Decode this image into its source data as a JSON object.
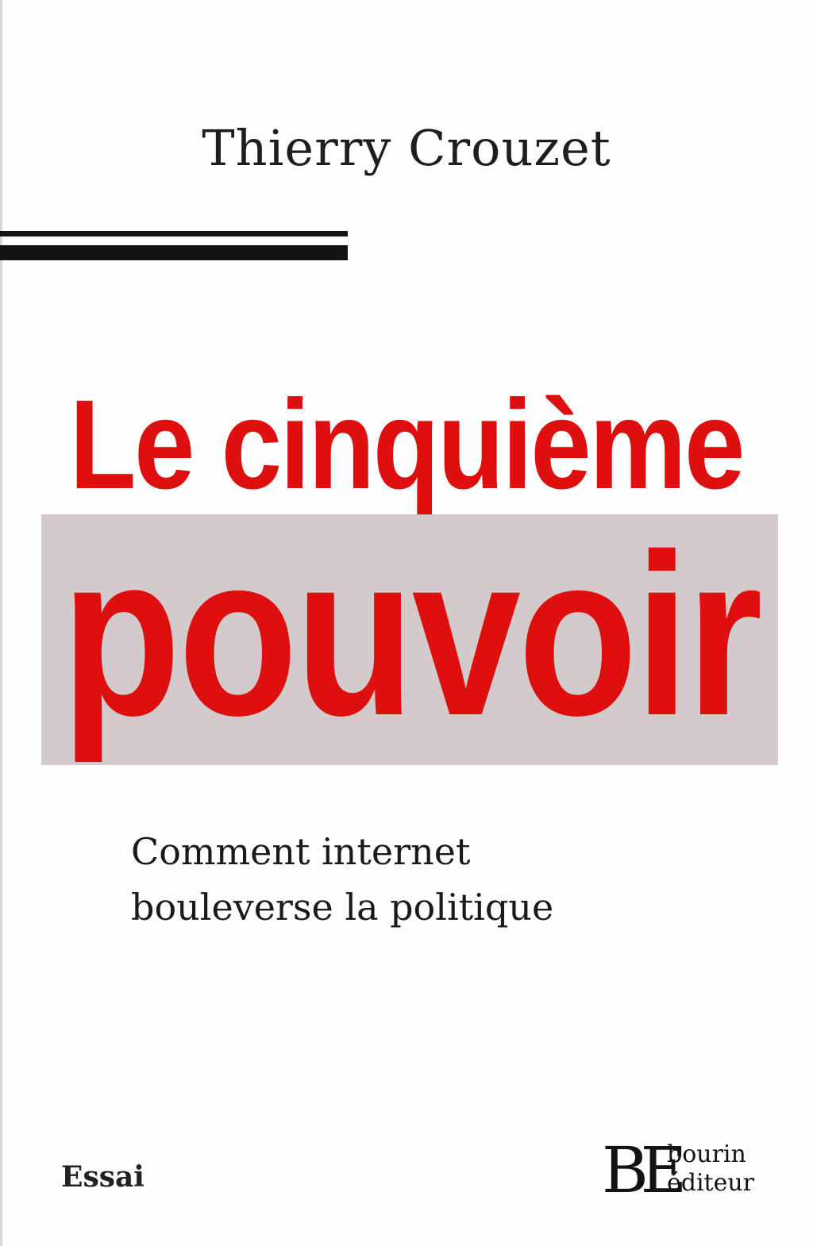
{
  "book": {
    "author": "Thierry Crouzet",
    "title_line1": "Le cinquième",
    "title_line2": "pouvoir",
    "subtitle_line1": "Comment internet",
    "subtitle_line2": "bouleverse la politique",
    "collection": "Essai",
    "publisher": {
      "mark": "BE",
      "line1": "bourin",
      "line2": "éditeur"
    }
  },
  "colors": {
    "title_red": "#dd0f0f",
    "band_gray": "#d3cbcb",
    "rule_black": "#141414"
  }
}
